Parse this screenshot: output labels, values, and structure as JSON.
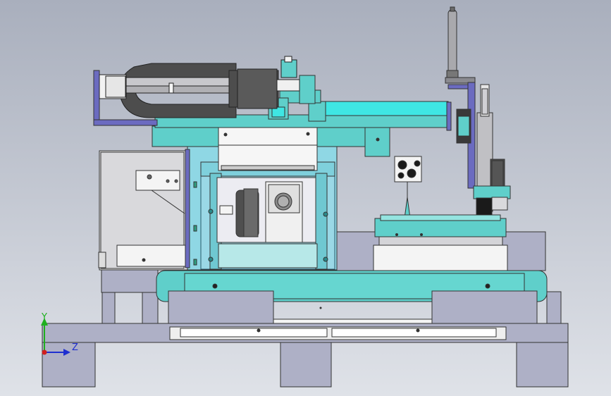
{
  "viewport": {
    "background_top": "#a9afbd",
    "background_bottom": "#dfe2e8"
  },
  "colors": {
    "frame_gray": "#aeb0c6",
    "teal": "#5fcfca",
    "teal_light": "#94e4e0",
    "cyan_bright": "#3fe6e3",
    "blue_translucent": "#8fd7e4",
    "dark_gray": "#4d4d4d",
    "black": "#111111",
    "purple": "#6b6bc0",
    "white_part": "#f4f4f4",
    "light_gray": "#d4d4d8"
  },
  "axes": {
    "y_label": "Y",
    "z_label": "Z",
    "y_color": "#1fb01f",
    "z_color": "#1f2fd0",
    "origin_color": "#d01f1f"
  }
}
